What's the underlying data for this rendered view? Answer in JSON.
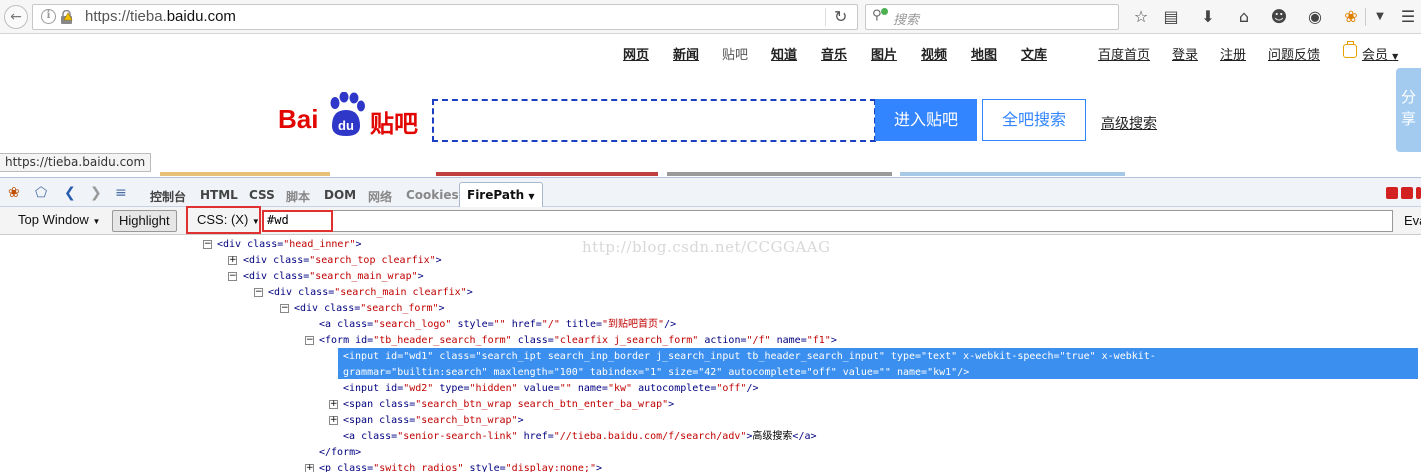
{
  "browser": {
    "url_prefix": "https://tieba.",
    "url_domain": "baidu.com",
    "search_placeholder": "搜索"
  },
  "baidu_nav": {
    "items": [
      "网页",
      "新闻",
      "贴吧",
      "知道",
      "音乐",
      "图片",
      "视频",
      "地图",
      "文库"
    ],
    "right_items": [
      "百度首页",
      "登录",
      "注册",
      "问题反馈"
    ],
    "member": "会员"
  },
  "share": "分享",
  "logo": {
    "bai": "Bai",
    "du": "du",
    "tieba": "贴吧"
  },
  "search": {
    "value": "",
    "enter_button": "进入贴吧",
    "all_button": "全吧搜索",
    "senior_link": "高级搜索"
  },
  "status_tip": "https://tieba.baidu.com",
  "devtools": {
    "tabs": [
      "控制台",
      "HTML",
      "CSS",
      "脚本",
      "DOM",
      "网络",
      "Cookies"
    ],
    "active_tab": "FirePath",
    "top_window": "Top Window",
    "highlight": "Highlight",
    "css_mode": "CSS: (X)",
    "query": "#wd",
    "eval": "Eva"
  },
  "watermark": "http://blog.csdn.net/CCGGAAG",
  "tree": [
    {
      "tog": "−",
      "parts": [
        [
          "tag",
          "<div  "
        ],
        [
          "an",
          "class="
        ],
        [
          "av",
          "\"head_inner\""
        ],
        [
          "tag",
          ">"
        ]
      ]
    },
    {
      "tog": "+",
      "parts": [
        [
          "tag",
          "<div  "
        ],
        [
          "an",
          "class="
        ],
        [
          "av",
          "\"search_top clearfix\""
        ],
        [
          "tag",
          ">"
        ]
      ]
    },
    {
      "tog": "−",
      "parts": [
        [
          "tag",
          "<div  "
        ],
        [
          "an",
          "class="
        ],
        [
          "av",
          "\"search_main_wrap\""
        ],
        [
          "tag",
          ">"
        ]
      ]
    },
    {
      "tog": "−",
      "parts": [
        [
          "tag",
          "<div  "
        ],
        [
          "an",
          "class="
        ],
        [
          "av",
          "\"search_main clearfix\""
        ],
        [
          "tag",
          ">"
        ]
      ]
    },
    {
      "tog": "−",
      "parts": [
        [
          "tag",
          "<div  "
        ],
        [
          "an",
          "class="
        ],
        [
          "av",
          "\"search_form\""
        ],
        [
          "tag",
          ">"
        ]
      ]
    },
    {
      "tog": "",
      "parts": [
        [
          "tag",
          "<a  "
        ],
        [
          "an",
          "class="
        ],
        [
          "av",
          "\"search_logo\""
        ],
        [
          "an",
          "  style="
        ],
        [
          "av",
          "\"\""
        ],
        [
          "an",
          "  href="
        ],
        [
          "av",
          "\"/\""
        ],
        [
          "an",
          "  title="
        ],
        [
          "av",
          "\"到贴吧首页\""
        ],
        [
          "tag",
          "/>"
        ]
      ]
    },
    {
      "tog": "−",
      "parts": [
        [
          "tag",
          "<form  "
        ],
        [
          "an",
          "id="
        ],
        [
          "av",
          "\"tb_header_search_form\""
        ],
        [
          "an",
          "  class="
        ],
        [
          "av",
          "\"clearfix j_search_form\""
        ],
        [
          "an",
          "  action="
        ],
        [
          "av",
          "\"/f\""
        ],
        [
          "an",
          "  name="
        ],
        [
          "av",
          "\"f1\""
        ],
        [
          "tag",
          ">"
        ]
      ]
    },
    {
      "tog": "",
      "parts": [
        [
          "tag",
          "<input  "
        ],
        [
          "an",
          "id="
        ],
        [
          "av",
          "\"wd1\""
        ],
        [
          "an",
          "  class="
        ],
        [
          "av",
          "\"search_ipt search_inp_border j_search_input tb_header_search_input\""
        ],
        [
          "an",
          "  type="
        ],
        [
          "av",
          "\"text\""
        ],
        [
          "an",
          "  x-webkit-speech="
        ],
        [
          "av",
          "\"true\""
        ],
        [
          "an",
          "  x-webkit-"
        ]
      ]
    },
    {
      "tog": "",
      "parts": [
        [
          "an",
          "grammar="
        ],
        [
          "av",
          "\"builtin:search\""
        ],
        [
          "an",
          "  maxlength="
        ],
        [
          "av",
          "\"100\""
        ],
        [
          "an",
          "  tabindex="
        ],
        [
          "av",
          "\"1\""
        ],
        [
          "an",
          "  size="
        ],
        [
          "av",
          "\"42\""
        ],
        [
          "an",
          "  autocomplete="
        ],
        [
          "av",
          "\"off\""
        ],
        [
          "an",
          "  value="
        ],
        [
          "av",
          "\"\""
        ],
        [
          "an",
          "  name="
        ],
        [
          "av",
          "\"kw1\""
        ],
        [
          "tag",
          "/>"
        ]
      ]
    },
    {
      "tog": "",
      "parts": [
        [
          "tag",
          "<input  "
        ],
        [
          "an",
          "id="
        ],
        [
          "av",
          "\"wd2\""
        ],
        [
          "an",
          "  type="
        ],
        [
          "av",
          "\"hidden\""
        ],
        [
          "an",
          "  value="
        ],
        [
          "av",
          "\"\""
        ],
        [
          "an",
          "  name="
        ],
        [
          "av",
          "\"kw\""
        ],
        [
          "an",
          "  autocomplete="
        ],
        [
          "av",
          "\"off\""
        ],
        [
          "tag",
          "/>"
        ]
      ]
    },
    {
      "tog": "+",
      "parts": [
        [
          "tag",
          "<span  "
        ],
        [
          "an",
          "class="
        ],
        [
          "av",
          "\"search_btn_wrap search_btn_enter_ba_wrap\""
        ],
        [
          "tag",
          ">"
        ]
      ]
    },
    {
      "tog": "+",
      "parts": [
        [
          "tag",
          "<span  "
        ],
        [
          "an",
          "class="
        ],
        [
          "av",
          "\"search_btn_wrap\""
        ],
        [
          "tag",
          ">"
        ]
      ]
    },
    {
      "tog": "",
      "parts": [
        [
          "tag",
          "<a  "
        ],
        [
          "an",
          "class="
        ],
        [
          "av",
          "\"senior-search-link\""
        ],
        [
          "an",
          "  href="
        ],
        [
          "av",
          "\"//tieba.baidu.com/f/search/adv\""
        ],
        [
          "tag",
          ">"
        ],
        [
          "txt",
          "高级搜索"
        ],
        [
          "tag",
          "</a>"
        ]
      ]
    },
    {
      "tog": "",
      "parts": [
        [
          "tag",
          "</form>"
        ]
      ]
    },
    {
      "tog": "+",
      "parts": [
        [
          "tag",
          "<p  "
        ],
        [
          "an",
          "class="
        ],
        [
          "av",
          "\"switch_radios\""
        ],
        [
          "an",
          "  style="
        ],
        [
          "av",
          "\"display:none;\""
        ],
        [
          "tag",
          ">"
        ]
      ]
    }
  ]
}
